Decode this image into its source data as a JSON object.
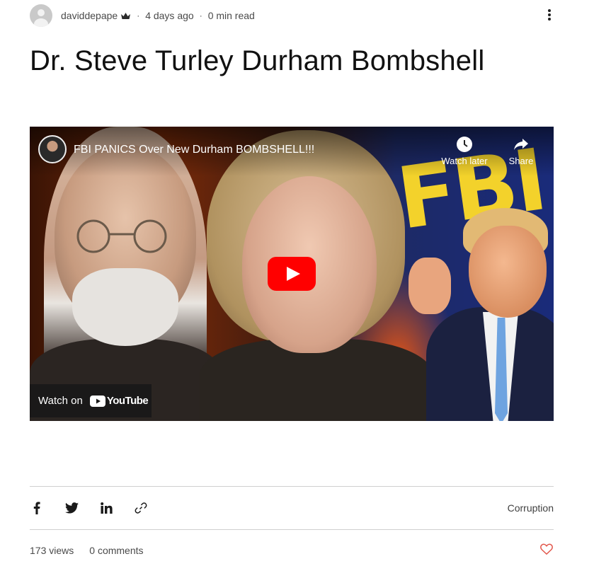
{
  "post_header": {
    "author": "daviddepape",
    "time_ago": "4 days ago",
    "read_time": "0 min read",
    "separator": "·"
  },
  "post": {
    "title": "Dr. Steve Turley Durham Bombshell"
  },
  "video": {
    "title": "FBI PANICS Over New Durham BOMBSHELL!!!",
    "watch_later_label": "Watch later",
    "share_label": "Share",
    "watch_on_label": "Watch on",
    "youtube_label": "YouTube",
    "thumbnail_text": "FBI"
  },
  "share_bar": {
    "icons": [
      "facebook-icon",
      "twitter-icon",
      "linkedin-icon",
      "link-icon"
    ],
    "category": "Corruption"
  },
  "footer": {
    "views": "173 views",
    "comments": "0 comments"
  },
  "colors": {
    "youtube_red": "#ff0000",
    "heart_red": "#e2574c",
    "fbi_yellow": "#f3d22b"
  }
}
